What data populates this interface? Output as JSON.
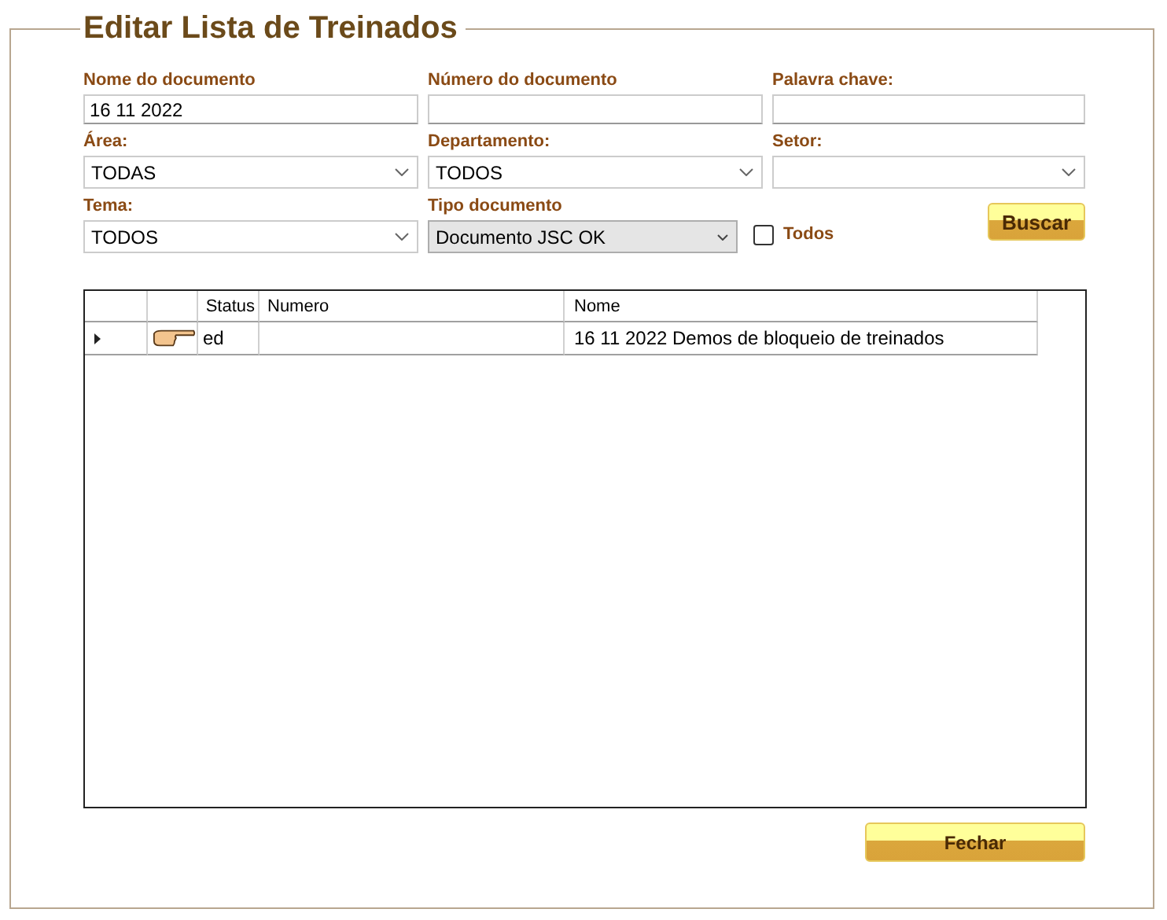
{
  "title": "Editar Lista de Treinados",
  "fields": [
    {
      "kind": "text",
      "label": "Nome do documento",
      "value": "16 11 2022"
    },
    {
      "kind": "text",
      "label": "Número do documento"
    },
    {
      "kind": "text",
      "label": "Palavra chave:"
    },
    {
      "kind": "combo",
      "label": "Área:",
      "value": "TODAS"
    },
    {
      "kind": "combo",
      "label": "Departamento:",
      "value": "TODOS"
    },
    {
      "kind": "combo",
      "label": "Setor:"
    },
    {
      "kind": "combo",
      "label": "Tema:",
      "value": "TODOS"
    },
    {
      "kind": "dropdown",
      "label": "Tipo documento",
      "value": "Documento JSC OK"
    }
  ],
  "todos": {
    "label": "Todos",
    "checked": false
  },
  "search_button": "Buscar",
  "table": {
    "columns": [
      "Status",
      "Numero",
      "Nome"
    ],
    "rows": [
      {
        "selected": true,
        "cells": [
          "ed",
          "",
          "16 11 2022 Demos de bloqueio de treinados"
        ]
      }
    ]
  },
  "close_button": "Fechar"
}
